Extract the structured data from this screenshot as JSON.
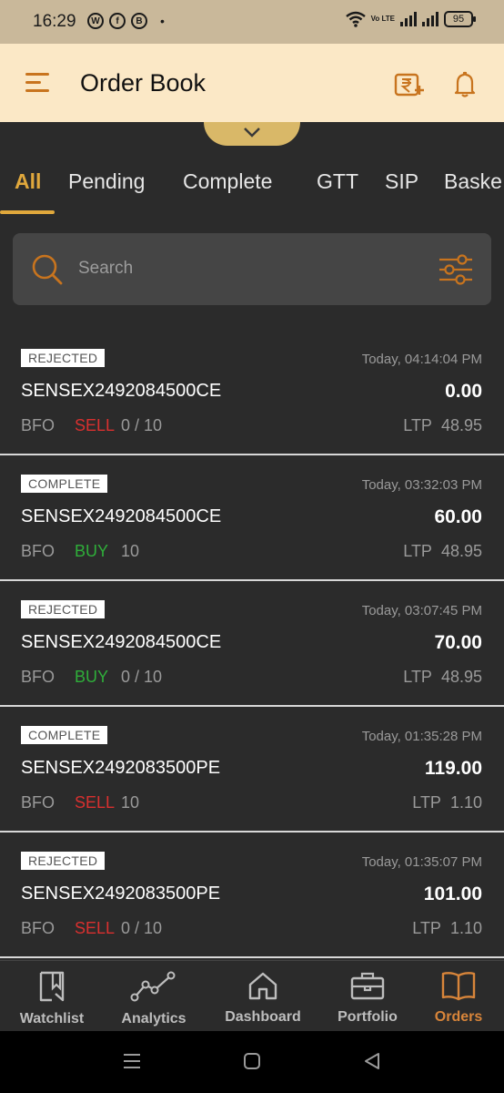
{
  "status_bar": {
    "time": "16:29",
    "apps": [
      "W",
      "f",
      "B"
    ],
    "bullet": "•",
    "network": "Vo LTE",
    "battery": "95"
  },
  "header": {
    "title": "Order Book",
    "icons": [
      "menu-icon",
      "rupee-add-icon",
      "bell-icon"
    ],
    "accent": "#c8741e",
    "background": "#fbe8c6"
  },
  "tabs": [
    {
      "label": "All",
      "active": true
    },
    {
      "label": "Pending"
    },
    {
      "label": "Complete"
    },
    {
      "label": "GTT"
    },
    {
      "label": "SIP"
    },
    {
      "label": "Baske"
    }
  ],
  "search": {
    "placeholder": "Search",
    "value": ""
  },
  "orders": [
    {
      "status": "REJECTED",
      "time": "Today, 04:14:04 PM",
      "symbol": "SENSEX2492084500CE",
      "price": "0.00",
      "exchange": "BFO",
      "side": "SELL",
      "qty": "0 / 10",
      "ltp_label": "LTP",
      "ltp": "48.95"
    },
    {
      "status": "COMPLETE",
      "time": "Today, 03:32:03 PM",
      "symbol": "SENSEX2492084500CE",
      "price": "60.00",
      "exchange": "BFO",
      "side": "BUY",
      "qty": "10",
      "ltp_label": "LTP",
      "ltp": "48.95"
    },
    {
      "status": "REJECTED",
      "time": "Today, 03:07:45 PM",
      "symbol": "SENSEX2492084500CE",
      "price": "70.00",
      "exchange": "BFO",
      "side": "BUY",
      "qty": "0 / 10",
      "ltp_label": "LTP",
      "ltp": "48.95"
    },
    {
      "status": "COMPLETE",
      "time": "Today, 01:35:28 PM",
      "symbol": "SENSEX2492083500PE",
      "price": "119.00",
      "exchange": "BFO",
      "side": "SELL",
      "qty": "10",
      "ltp_label": "LTP",
      "ltp": "1.10"
    },
    {
      "status": "REJECTED",
      "time": "Today, 01:35:07 PM",
      "symbol": "SENSEX2492083500PE",
      "price": "101.00",
      "exchange": "BFO",
      "side": "SELL",
      "qty": "0 / 10",
      "ltp_label": "LTP",
      "ltp": "1.10"
    }
  ],
  "bottom_nav": [
    {
      "label": "Watchlist",
      "icon": "bookmark-icon"
    },
    {
      "label": "Analytics",
      "icon": "analytics-icon"
    },
    {
      "label": "Dashboard",
      "icon": "home-icon"
    },
    {
      "label": "Portfolio",
      "icon": "briefcase-icon"
    },
    {
      "label": "Orders",
      "icon": "book-icon",
      "active": true
    }
  ],
  "colors": {
    "sell": "#d9302f",
    "buy": "#2fae3a",
    "active_tab": "#e0a83c",
    "active_nav": "#d8853a"
  }
}
